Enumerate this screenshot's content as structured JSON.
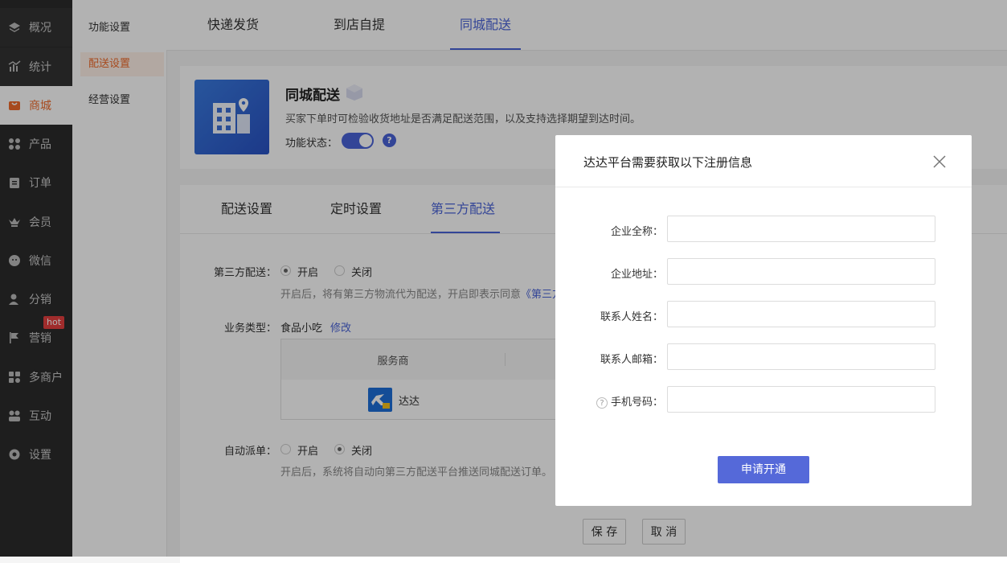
{
  "leftnav": {
    "items": [
      {
        "label": "概况",
        "icon": "layers-icon"
      },
      {
        "label": "统计",
        "icon": "chart-icon"
      },
      {
        "label": "商城",
        "icon": "shop-icon"
      },
      {
        "label": "产品",
        "icon": "grid-icon"
      },
      {
        "label": "订单",
        "icon": "clipboard-icon"
      },
      {
        "label": "会员",
        "icon": "crown-icon"
      },
      {
        "label": "微信",
        "icon": "wechat-icon"
      },
      {
        "label": "分销",
        "icon": "user-share-icon"
      },
      {
        "label": "营销",
        "icon": "flag-icon"
      },
      {
        "label": "多商户",
        "icon": "merchant-icon"
      },
      {
        "label": "互动",
        "icon": "interact-icon"
      },
      {
        "label": "设置",
        "icon": "gear-icon"
      }
    ],
    "hot_badge": "hot"
  },
  "subnav": {
    "items": [
      {
        "label": "功能设置"
      },
      {
        "label": "配送设置"
      },
      {
        "label": "经营设置"
      }
    ]
  },
  "toptabs": [
    {
      "label": "快递发货"
    },
    {
      "label": "到店自提"
    },
    {
      "label": "同城配送"
    }
  ],
  "feature": {
    "title": "同城配送",
    "desc": "买家下单时可检验收货地址是否满足配送范围，以及支持选择期望到达时间。",
    "status_label": "功能状态：",
    "help": "?"
  },
  "inner_tabs": [
    {
      "label": "配送设置"
    },
    {
      "label": "定时设置"
    },
    {
      "label": "第三方配送"
    }
  ],
  "form": {
    "third_party_label": "第三方配送：",
    "open": "开启",
    "close": "关闭",
    "third_party_hint": "开启后，将有第三方物流代为配送，开启即表示同意",
    "third_party_link": "《第三方",
    "biz_type_label": "业务类型：",
    "biz_type_value": "食品小吃",
    "modify": "修改",
    "table_header": "服务商",
    "provider": "达达",
    "auto_dispatch_label": "自动派单：",
    "auto_hint": "开启后，系统将自动向第三方配送平台推送同城配送订单。",
    "save": "保 存",
    "cancel": "取 消"
  },
  "modal": {
    "title": "达达平台需要获取以下注册信息",
    "fields": [
      {
        "label": "企业全称："
      },
      {
        "label": "企业地址："
      },
      {
        "label": "联系人姓名："
      },
      {
        "label": "联系人邮箱："
      },
      {
        "label": "手机号码："
      }
    ],
    "help": "?",
    "submit": "申请开通"
  },
  "colors": {
    "accent": "#4a63d8",
    "brand_orange": "#ef6b2b",
    "nav_bg": "#2b2b2b"
  }
}
